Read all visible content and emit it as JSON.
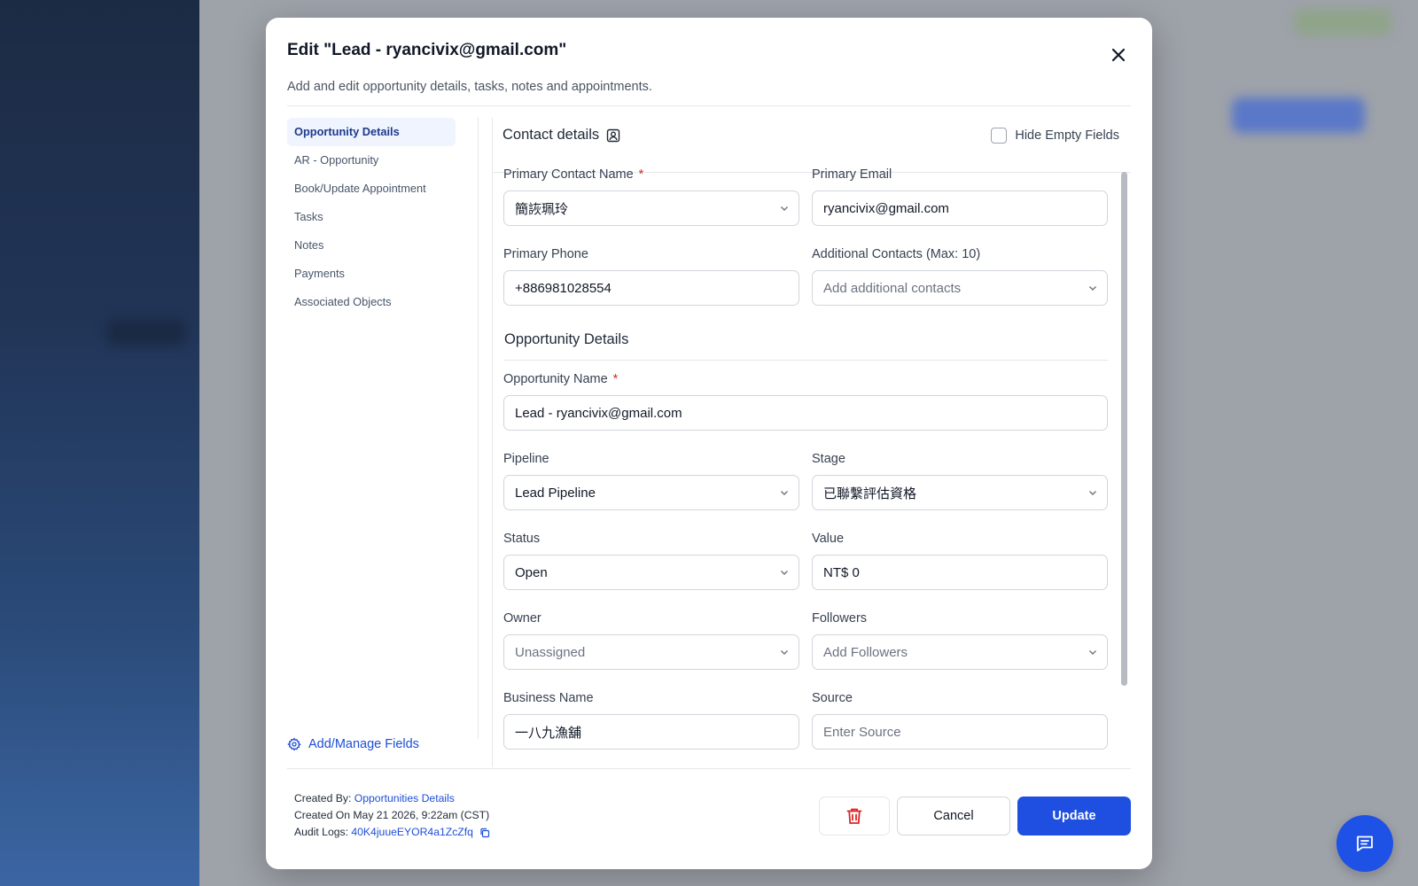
{
  "modal": {
    "title": "Edit \"Lead - ryancivix@gmail.com\"",
    "subtitle": "Add and edit opportunity details, tasks, notes and appointments."
  },
  "nav": {
    "items": [
      {
        "label": "Opportunity Details",
        "active": true
      },
      {
        "label": "AR - Opportunity"
      },
      {
        "label": "Book/Update Appointment"
      },
      {
        "label": "Tasks"
      },
      {
        "label": "Notes"
      },
      {
        "label": "Payments"
      },
      {
        "label": "Associated Objects"
      }
    ],
    "manage_fields": "Add/Manage Fields"
  },
  "contact": {
    "title": "Contact details",
    "hide_empty_label": "Hide Empty Fields",
    "hide_empty_checked": false
  },
  "fields": {
    "primary_contact_name": {
      "label": "Primary Contact Name",
      "value": "簡詼珮玲"
    },
    "primary_email": {
      "label": "Primary Email",
      "value": "ryancivix@gmail.com"
    },
    "primary_phone": {
      "label": "Primary Phone",
      "value": "+886981028554"
    },
    "additional_contacts": {
      "label": "Additional Contacts (Max: 10)",
      "placeholder": "Add additional contacts"
    },
    "opportunity_section": "Opportunity Details",
    "opportunity_name": {
      "label": "Opportunity Name",
      "value": "Lead - ryancivix@gmail.com"
    },
    "pipeline": {
      "label": "Pipeline",
      "value": "Lead Pipeline"
    },
    "stage": {
      "label": "Stage",
      "value": "已聯繫評估資格"
    },
    "status": {
      "label": "Status",
      "value": "Open"
    },
    "value": {
      "label": "Value",
      "value": "NT$ 0"
    },
    "owner": {
      "label": "Owner",
      "value": "Unassigned"
    },
    "followers": {
      "label": "Followers",
      "placeholder": "Add Followers"
    },
    "business_name": {
      "label": "Business Name",
      "value": "一八九漁舖"
    },
    "source": {
      "label": "Source",
      "placeholder": "Enter Source"
    }
  },
  "required_mark": "*",
  "footer": {
    "created_by_label": "Created By:",
    "created_by_value": "Opportunities Details",
    "created_on": "Created On May 21 2026, 9:22am (CST)",
    "audit_label": "Audit Logs:",
    "audit_value": "40K4juueEYOR4a1ZcZfq",
    "cancel_label": "Cancel",
    "update_label": "Update"
  },
  "colors": {
    "primary": "#1f4fe0",
    "danger": "#dc2626",
    "nav_active_bg": "#eff4ff"
  },
  "icons": {
    "close": "close-icon",
    "contact": "contact-card-icon",
    "gear": "gear-icon",
    "trash": "trash-icon",
    "copy": "copy-icon",
    "chat": "chat-icon",
    "chevron": "chevron-down-icon"
  }
}
